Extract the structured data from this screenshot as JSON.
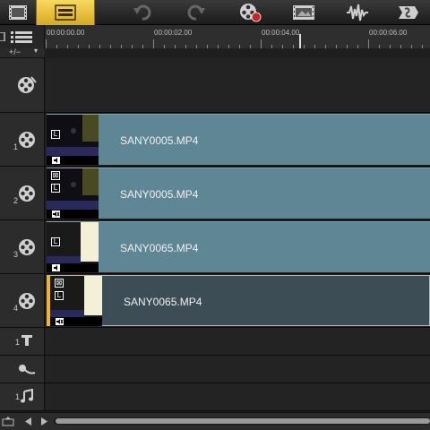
{
  "toolbar": {
    "buttons": [
      {
        "icon": "filmstrip-icon",
        "state": "normal"
      },
      {
        "icon": "timeline-view-icon",
        "state": "active"
      },
      {
        "icon": "undo-icon",
        "state": "disabled"
      },
      {
        "icon": "redo-icon",
        "state": "disabled"
      },
      {
        "icon": "record-capture-icon",
        "state": "normal"
      },
      {
        "icon": "movie-frame-icon",
        "state": "normal"
      },
      {
        "icon": "audio-waveform-icon",
        "state": "normal"
      },
      {
        "icon": "auto-music-icon",
        "state": "normal"
      }
    ]
  },
  "ruler": {
    "timecodes": [
      "00:00:00.00",
      "00:00:02.00",
      "00:00:04.00",
      "00:00:06.00"
    ]
  },
  "track_controls": {
    "toggle_label": "+/−"
  },
  "tracks": {
    "video": {
      "label": ""
    },
    "overlays": [
      {
        "number": "1",
        "clip": "SANY0005.MP4",
        "selected": false,
        "thumb_style": "dark",
        "audio_badge": "speaker"
      },
      {
        "number": "2",
        "clip": "SANY0005.MP4",
        "selected": false,
        "thumb_style": "dark",
        "audio_badge": "muted"
      },
      {
        "number": "3",
        "clip": "SANY0065.MP4",
        "selected": false,
        "thumb_style": "light",
        "audio_badge": "speaker"
      },
      {
        "number": "4",
        "clip": "SANY0065.MP4",
        "selected": true,
        "thumb_style": "light",
        "audio_badge": "muted"
      }
    ],
    "title": {
      "number": "1"
    },
    "voice": {
      "number": ""
    },
    "music": {
      "number": "1"
    }
  },
  "colors": {
    "accent": "#f2b42a",
    "clip": "#5f8694",
    "clip_selected": "#3c4d55"
  }
}
